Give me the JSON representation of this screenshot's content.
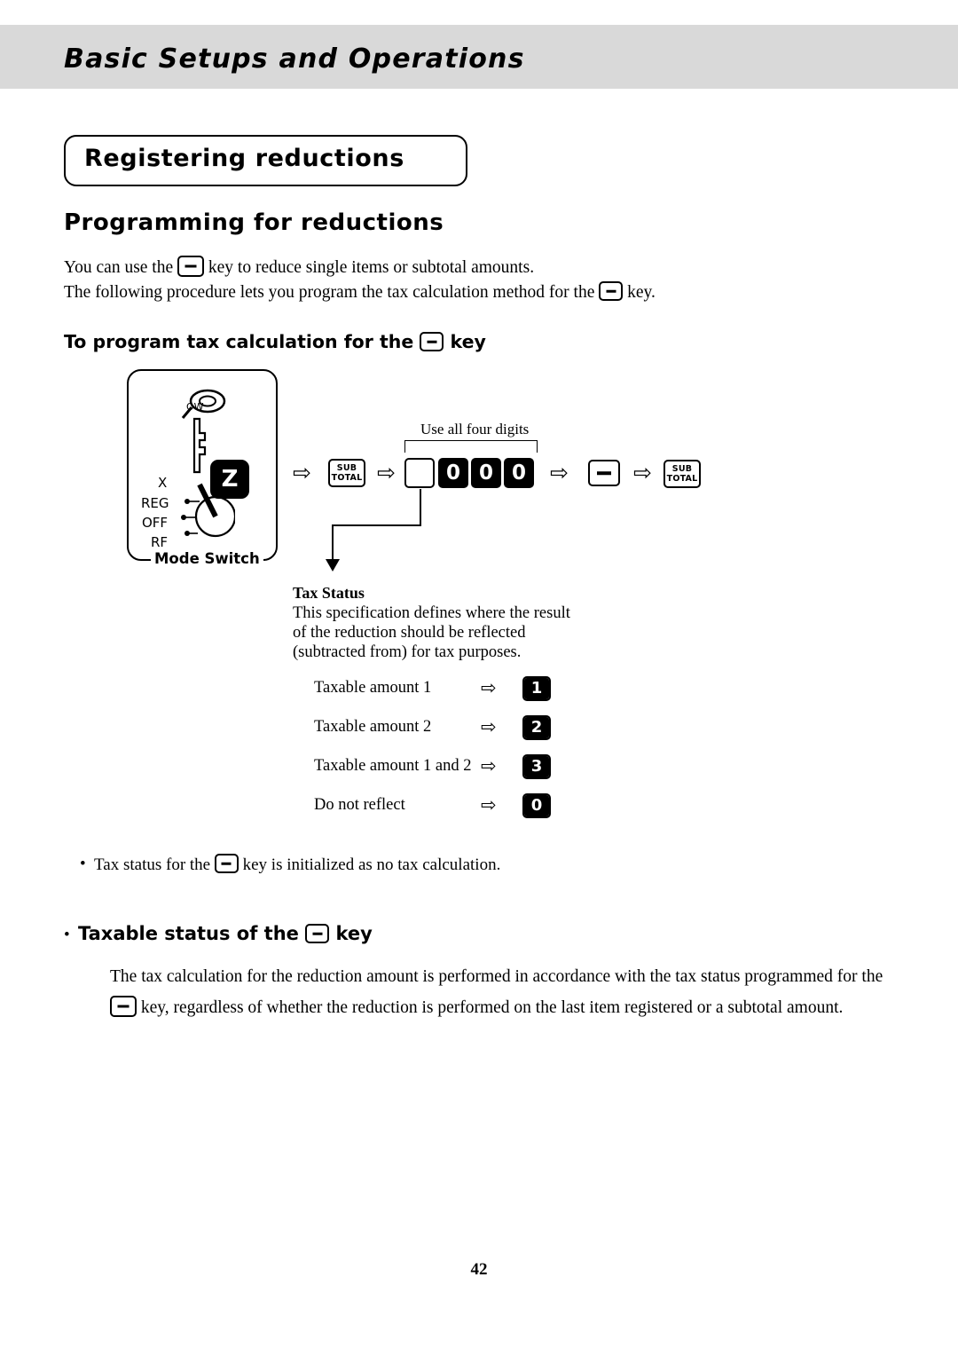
{
  "header": {
    "title": "Basic Setups and Operations"
  },
  "section": {
    "title": "Registering reductions",
    "subtitle": "Programming for reductions",
    "paragraph_1_before": "You can use the",
    "paragraph_1_after": "key to reduce single items or subtotal amounts.",
    "paragraph_2_before": "The following procedure lets you program the tax calculation method for the",
    "paragraph_2_after": "key.",
    "procedure_heading_before": "To program tax calculation for the",
    "procedure_heading_after": "key"
  },
  "mode_switch": {
    "caption": "Mode Switch",
    "knob_letter": "Z",
    "labels": {
      "ow": "OW",
      "x": "X",
      "reg": "REG",
      "off": "OFF",
      "rf": "RF"
    }
  },
  "flow": {
    "use_all_four_digits": "Use all four digits",
    "sub_label": "SUB",
    "total_label": "TOTAL",
    "digits": [
      "0",
      "0",
      "0"
    ],
    "arrow": "⇨"
  },
  "tax_status": {
    "title": "Tax Status",
    "description": "This specification defines where the result of the reduction should be reflected (subtracted from) for tax purposes.",
    "rows": [
      {
        "label": "Taxable amount 1",
        "value": "1"
      },
      {
        "label": "Taxable amount 2",
        "value": "2"
      },
      {
        "label": "Taxable amount 1 and 2",
        "value": "3"
      },
      {
        "label": "Do not reflect",
        "value": "0"
      }
    ]
  },
  "notes": {
    "bullet_char": "•",
    "note_before": "Tax status for the",
    "note_after": "key is initialized as no tax calculation.",
    "subheading_before": "Taxable status of the",
    "subheading_after": "key",
    "body_line_1": "The tax calculation for the reduction amount is performed in accordance with the tax status programmed for the",
    "body_line_2_after": "key, regardless of whether the reduction is performed on the last item registered or a subtotal amount."
  },
  "footer": {
    "page_number": "42"
  }
}
